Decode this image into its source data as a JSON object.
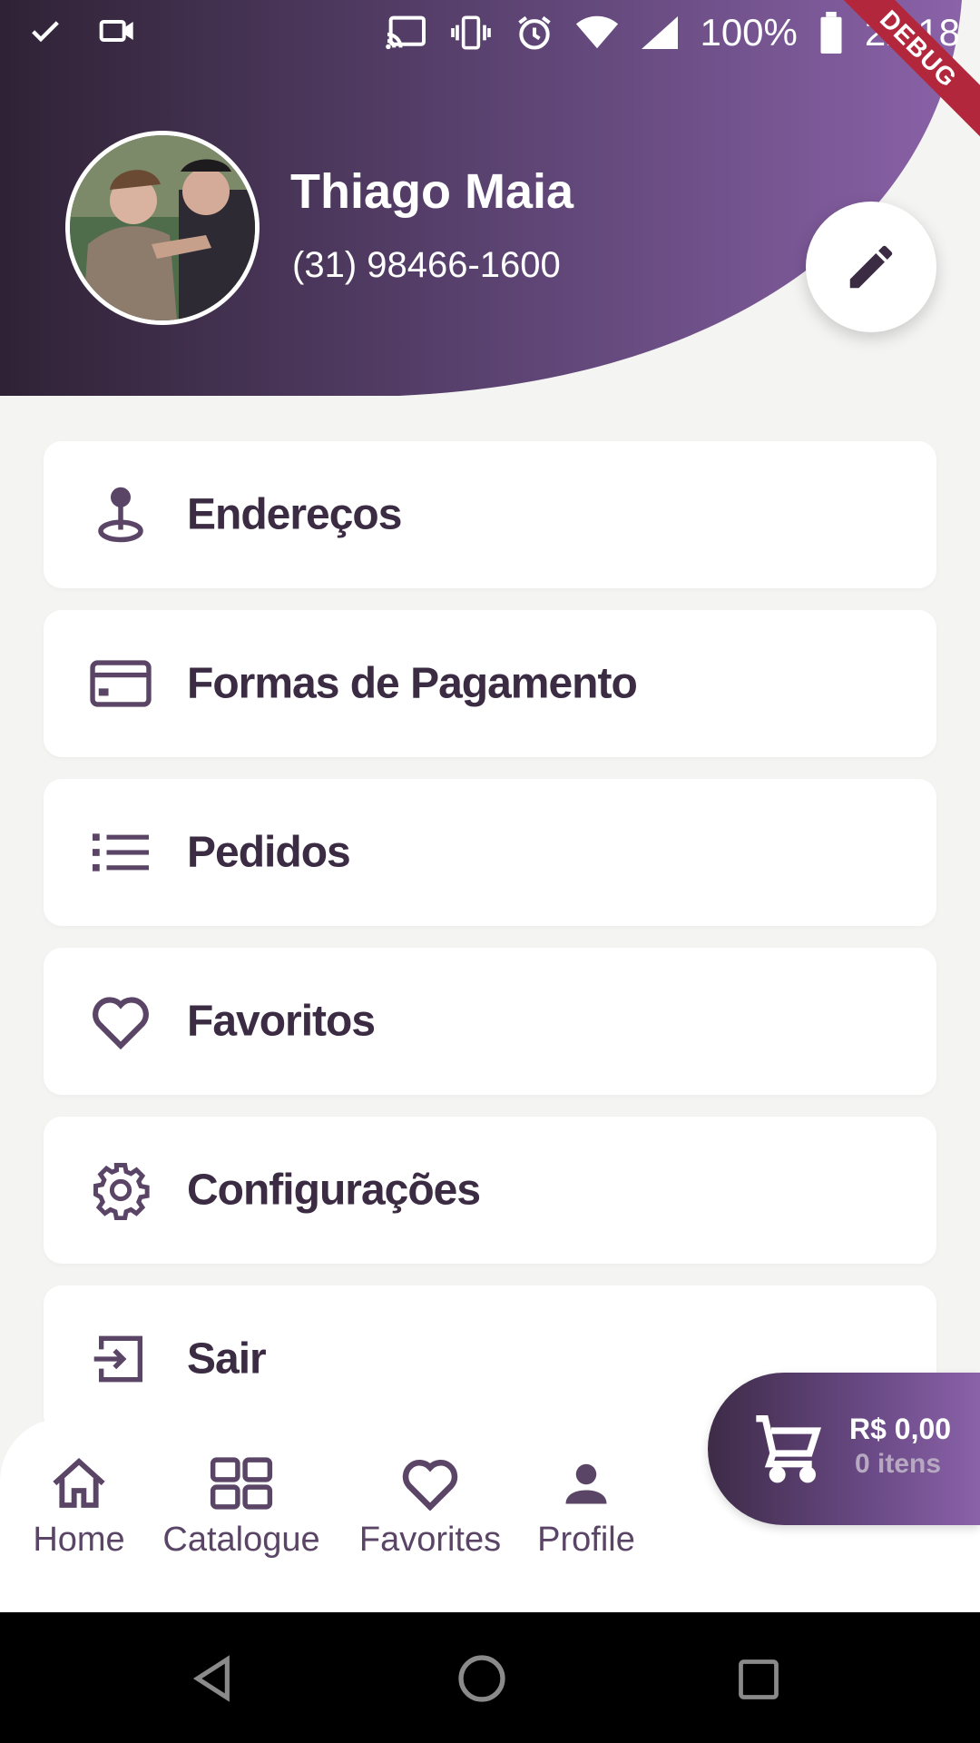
{
  "status_bar": {
    "battery": "100%",
    "time": "22:18",
    "icons": [
      "check-icon",
      "video-camera-icon",
      "cast-icon",
      "vibrate-icon",
      "alarm-icon",
      "wifi-icon",
      "signal-icon",
      "battery-icon"
    ]
  },
  "debug_banner": "DEBUG",
  "profile": {
    "name": "Thiago Maia",
    "phone": "(31) 98466-1600"
  },
  "menu": {
    "items": [
      {
        "label": "Endereços",
        "icon": "location-pin-icon"
      },
      {
        "label": "Formas de Pagamento",
        "icon": "credit-card-icon"
      },
      {
        "label": "Pedidos",
        "icon": "list-icon"
      },
      {
        "label": "Favoritos",
        "icon": "heart-icon"
      },
      {
        "label": "Configurações",
        "icon": "gear-icon"
      },
      {
        "label": "Sair",
        "icon": "logout-icon"
      }
    ]
  },
  "bottom_nav": {
    "items": [
      {
        "label": "Home",
        "icon": "home-icon"
      },
      {
        "label": "Catalogue",
        "icon": "grid-icon"
      },
      {
        "label": "Favorites",
        "icon": "heart-icon"
      },
      {
        "label": "Profile",
        "icon": "person-icon"
      }
    ]
  },
  "cart": {
    "total": "R$ 0,00",
    "count": "0 itens"
  },
  "colors": {
    "brand_dark": "#2f2235",
    "brand_light": "#8a62a8",
    "icon": "#5a4566",
    "background": "#f4f4f3"
  }
}
